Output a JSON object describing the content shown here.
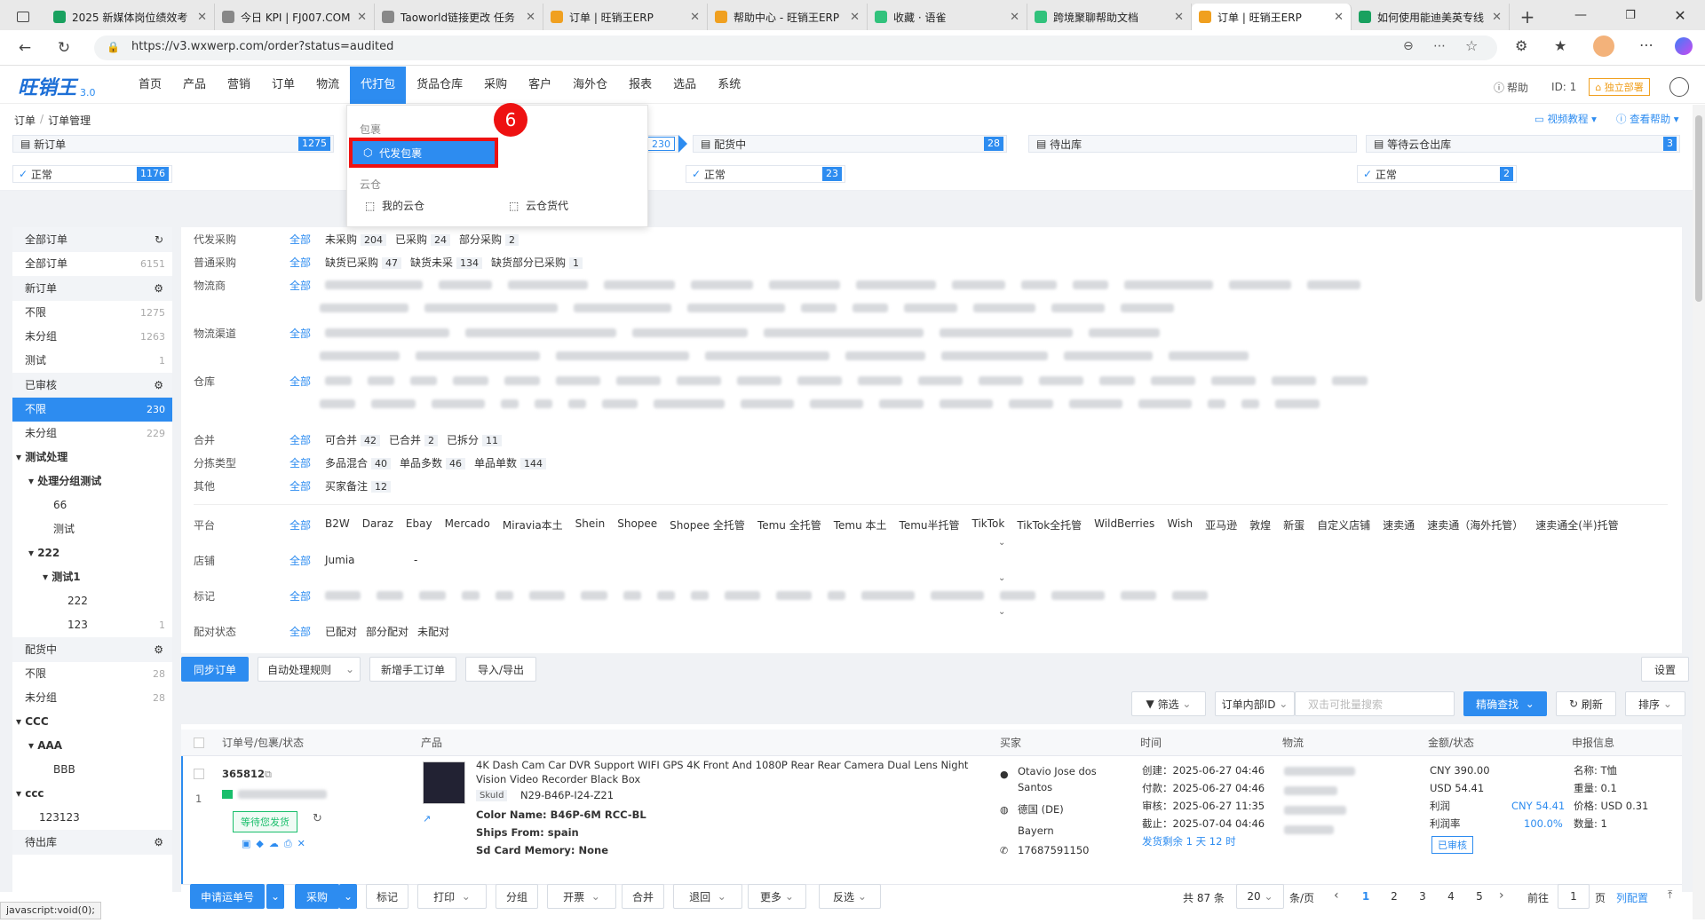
{
  "browser": {
    "tabs": [
      {
        "title": "2025 新媒体岗位绩效考",
        "color": "#19a15f"
      },
      {
        "title": "今日 KPI | FJ007.COM",
        "color": "#888888"
      },
      {
        "title": "Taoworld链接更改 任务",
        "color": "#888888"
      },
      {
        "title": "订单 | 旺销王ERP",
        "color": "#f0a020"
      },
      {
        "title": "帮助中心 - 旺销王ERP",
        "color": "#f0a020"
      },
      {
        "title": "收藏 · 语雀",
        "color": "#31c27c"
      },
      {
        "title": "跨境聚聊帮助文档",
        "color": "#31c27c"
      },
      {
        "title": "订单 | 旺销王ERP",
        "color": "#f0a020"
      },
      {
        "title": "如何使用能迪美英专线",
        "color": "#19a15f"
      }
    ],
    "url": "https://v3.wxwerp.com/order?status=audited"
  },
  "app": {
    "logo": "旺销王",
    "version": "3.0",
    "menu": [
      "首页",
      "产品",
      "营销",
      "订单",
      "物流",
      "代打包",
      "货品仓库",
      "采购",
      "客户",
      "海外仓",
      "报表",
      "选品",
      "系统"
    ],
    "help": "帮助",
    "id_label": "ID: 1",
    "deploy": "独立部署",
    "breadcrumb": [
      "订单",
      "订单管理"
    ],
    "video_tutorial": "视频教程",
    "view_help": "查看帮助"
  },
  "pipeline": [
    {
      "label": "新订单",
      "count": "1275",
      "sub": "正常",
      "sub_count": "1176"
    },
    {
      "label": "",
      "count": "230",
      "sub": "",
      "sub_count": ""
    },
    {
      "label": "配货中",
      "count": "28",
      "sub": "正常",
      "sub_count": "23"
    },
    {
      "label": "待出库",
      "count": "",
      "sub": "",
      "sub_count": ""
    },
    {
      "label": "等待云仓出库",
      "count": "3",
      "sub": "正常",
      "sub_count": "2"
    }
  ],
  "dropdown": {
    "sec1": "包裹",
    "item1": "代发包裹",
    "sec2": "云仓",
    "item2": "我的云仓",
    "item3": "云仓货代",
    "badge": "6"
  },
  "sidebar": {
    "all_title": "全部订单",
    "all_item": "全部订单",
    "all_count": "6151",
    "new_title": "新订单",
    "new_items": [
      {
        "l": "不限",
        "n": "1275"
      },
      {
        "l": "未分组",
        "n": "1263"
      },
      {
        "l": "测试",
        "n": "1"
      }
    ],
    "aud_title": "已审核",
    "aud_items": [
      {
        "l": "不限",
        "n": "230"
      },
      {
        "l": "未分组",
        "n": "229"
      }
    ],
    "tree1": [
      "测试处理",
      "处理分组测试",
      "66",
      "测试",
      "222",
      "测试1",
      "222",
      "123"
    ],
    "tree1_count": "1",
    "pk_title": "配货中",
    "pk_items": [
      {
        "l": "不限",
        "n": "28"
      },
      {
        "l": "未分组",
        "n": "28"
      }
    ],
    "tree2": [
      "CCC",
      "AAA",
      "BBB",
      "ccc",
      "123123"
    ],
    "out_title": "待出库"
  },
  "filters": {
    "all": "全部",
    "r1": {
      "label": "代发采购",
      "opts": [
        {
          "t": "未采购",
          "n": "204"
        },
        {
          "t": "已采购",
          "n": "24"
        },
        {
          "t": "部分采购",
          "n": "2"
        }
      ]
    },
    "r2": {
      "label": "普通采购",
      "opts": [
        {
          "t": "缺货已采购",
          "n": "47"
        },
        {
          "t": "缺货未采",
          "n": "134"
        },
        {
          "t": "缺货部分已采购",
          "n": "1"
        }
      ]
    },
    "r3": {
      "label": "物流商"
    },
    "r4": {
      "label": "物流渠道"
    },
    "r5": {
      "label": "仓库"
    },
    "r6": {
      "label": "合并",
      "opts": [
        {
          "t": "可合并",
          "n": "42"
        },
        {
          "t": "已合并",
          "n": "2"
        },
        {
          "t": "已拆分",
          "n": "11"
        }
      ]
    },
    "r7": {
      "label": "分拣类型",
      "opts": [
        {
          "t": "多品混合",
          "n": "40"
        },
        {
          "t": "单品多数",
          "n": "46"
        },
        {
          "t": "单品单数",
          "n": "144"
        }
      ]
    },
    "r8": {
      "label": "其他",
      "opts": [
        {
          "t": "买家备注",
          "n": "12"
        }
      ]
    },
    "platform_label": "平台",
    "platforms": [
      "B2W",
      "Daraz",
      "Ebay",
      "Mercado",
      "Miravia本土",
      "Shein",
      "Shopee",
      "Shopee 全托管",
      "Temu 全托管",
      "Temu 本土",
      "Temu半托管",
      "TikTok",
      "TikTok全托管",
      "WildBerries",
      "Wish",
      "亚马逊",
      "敦煌",
      "新蛋",
      "自定义店铺",
      "速卖通",
      "速卖通（海外托管）",
      "速卖通全(半)托管"
    ],
    "shop_label": "店铺",
    "shop": "Jumia",
    "shop_dash": "-",
    "mark_label": "标记",
    "match_label": "配对状态",
    "match": [
      "已配对",
      "部分配对",
      "未配对"
    ]
  },
  "toolbar": {
    "sync": "同步订单",
    "auto": "自动处理规则",
    "manual": "新增手工订单",
    "io": "导入/导出",
    "settings": "设置",
    "filter": "筛选",
    "search_field": "订单内部ID",
    "search_ph": "双击可批量搜索",
    "exact": "精确查找",
    "refresh": "刷新",
    "sort": "排序"
  },
  "table": {
    "headers": [
      "订单号/包裹/状态",
      "产品",
      "买家",
      "时间",
      "物流",
      "金额/状态",
      "申报信息"
    ],
    "row": {
      "id": "365812",
      "index": "1",
      "status": "等待您发货",
      "title": "4K Dash Cam Car DVR Support WIFI GPS 4K Front And 1080P Rear Rear Camera Dual Lens Night Vision Video Recorder Black Box",
      "sku_tag": "SkuId",
      "sku": "N29-B46P-I24-Z21",
      "attr1": "Color Name: B46P-6M RCC-BL",
      "attr2": "Ships From: spain",
      "attr3": "Sd Card Memory: None",
      "buyer": "Otavio Jose dos Santos",
      "country": "德国 (DE)",
      "region": "Bayern",
      "phone": "17687591150",
      "t1": "创建：2025-06-27 04:46",
      "t2": "付款：2025-06-27 04:46",
      "t3": "审核：2025-06-27 11:35",
      "t4": "截止：2025-07-04 04:46",
      "remain": "发货剩余 1 天 12 时",
      "amt1": "CNY 390.00",
      "amt2": "USD 54.41",
      "profit_l": "利润",
      "profit": "CNY 54.41",
      "rate_l": "利润率",
      "rate": "100.0%",
      "audited": "已审核",
      "dec": [
        "名称: T恤",
        "重量: 0.1",
        "价格: USD 0.31",
        "数量: 1"
      ]
    }
  },
  "footer": {
    "apply": "申请运单号",
    "purchase": "采购",
    "mark": "标记",
    "print": "打印",
    "group": "分组",
    "invoice": "开票",
    "merge": "合并",
    "refund": "退回",
    "more": "更多",
    "invert": "反选",
    "total": "共 87 条",
    "per": "20",
    "per_unit": "条/页",
    "pages": [
      "1",
      "2",
      "3",
      "4",
      "5"
    ],
    "goto": "前往",
    "goto_val": "1",
    "page_unit": "页",
    "config": "列配置"
  },
  "statusbar": "javascript:void(0);"
}
